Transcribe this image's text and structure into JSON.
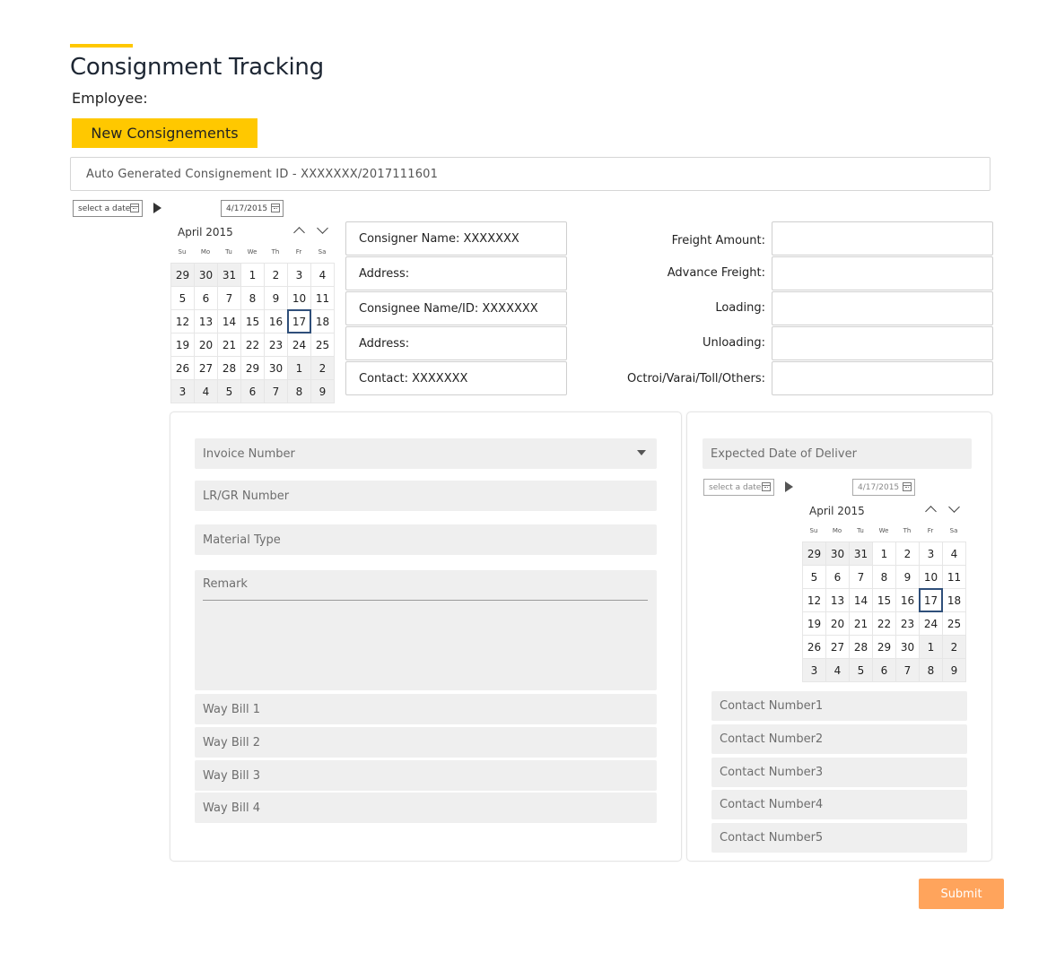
{
  "page": {
    "title": "Consignment Tracking",
    "employee_label": "Employee:",
    "new_button": "New Consignements",
    "auto_id": "Auto Generated Consignement ID - XXXXXXX/2017111601",
    "accent_color": "#FFC800",
    "submit_color": "#FFA45C"
  },
  "date_range_top": {
    "start_placeholder": "select a date",
    "end_value": "4/17/2015"
  },
  "calendar_top": {
    "month": "April 2015",
    "weekdays": [
      "Su",
      "Mo",
      "Tu",
      "We",
      "Th",
      "Fr",
      "Sa"
    ],
    "days": [
      "29",
      "30",
      "31",
      "1",
      "2",
      "3",
      "4",
      "5",
      "6",
      "7",
      "8",
      "9",
      "10",
      "11",
      "12",
      "13",
      "14",
      "15",
      "16",
      "17",
      "18",
      "19",
      "20",
      "21",
      "22",
      "23",
      "24",
      "25",
      "26",
      "27",
      "28",
      "29",
      "30",
      "1",
      "2",
      "3",
      "4",
      "5",
      "6",
      "7",
      "8",
      "9"
    ],
    "selected": "17"
  },
  "consigner": {
    "name": "Consigner Name: XXXXXXX",
    "address1": "Address:",
    "consignee": "Consignee Name/ID: XXXXXXX",
    "address2": "Address:",
    "contact": "Contact: XXXXXXX"
  },
  "freight": {
    "freight_amount": "Freight Amount:",
    "advance_freight": "Advance Freight:",
    "loading": "Loading:",
    "unloading": "Unloading:",
    "octroi": "Octroi/Varai/Toll/Others:"
  },
  "left_panel": {
    "invoice": "Invoice Number",
    "lrgr": "LR/GR Number",
    "material": "Material Type",
    "remark": "Remark",
    "waybill1": "Way Bill 1",
    "waybill2": "Way Bill 2",
    "waybill3": "Way Bill 3",
    "waybill4": "Way Bill 4"
  },
  "right_panel": {
    "expected": "Expected Date of Deliver",
    "start_placeholder": "select a date",
    "end_value": "4/17/2015",
    "contact1": "Contact Number1",
    "contact2": "Contact Number2",
    "contact3": "Contact Number3",
    "contact4": "Contact Number4",
    "contact5": "Contact Number5"
  },
  "calendar_bottom": {
    "month": "April 2015",
    "weekdays": [
      "Su",
      "Mo",
      "Tu",
      "We",
      "Th",
      "Fr",
      "Sa"
    ],
    "days": [
      "29",
      "30",
      "31",
      "1",
      "2",
      "3",
      "4",
      "5",
      "6",
      "7",
      "8",
      "9",
      "10",
      "11",
      "12",
      "13",
      "14",
      "15",
      "16",
      "17",
      "18",
      "19",
      "20",
      "21",
      "22",
      "23",
      "24",
      "25",
      "26",
      "27",
      "28",
      "29",
      "30",
      "1",
      "2",
      "3",
      "4",
      "5",
      "6",
      "7",
      "8",
      "9"
    ],
    "selected": "17"
  },
  "submit": "Submit"
}
